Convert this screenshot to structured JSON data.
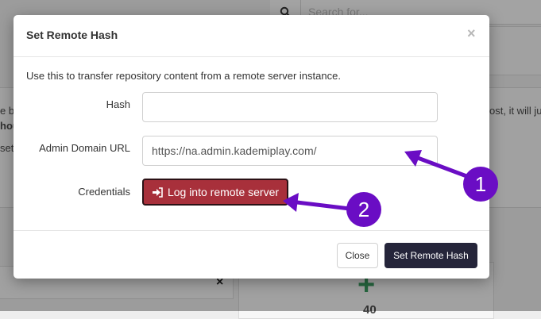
{
  "background": {
    "search_placeholder": "Search for...",
    "left_fragments": [
      "e b",
      "hou",
      "set"
    ],
    "right_fragment": "ost, it will ju",
    "panel_close": "×",
    "count_fragment": "40"
  },
  "modal": {
    "title": "Set Remote Hash",
    "close_symbol": "×",
    "description": "Use this to transfer repository content from a remote server instance.",
    "fields": {
      "hash": {
        "label": "Hash",
        "value": ""
      },
      "admin_domain_url": {
        "label": "Admin Domain URL",
        "value": "https://na.admin.kademiplay.com/"
      },
      "credentials": {
        "label": "Credentials",
        "button_label": "Log into remote server"
      }
    },
    "footer": {
      "close_label": "Close",
      "submit_label": "Set Remote Hash"
    }
  },
  "annotations": {
    "badge_1": "1",
    "badge_2": "2",
    "color": "#6a0dc4"
  }
}
